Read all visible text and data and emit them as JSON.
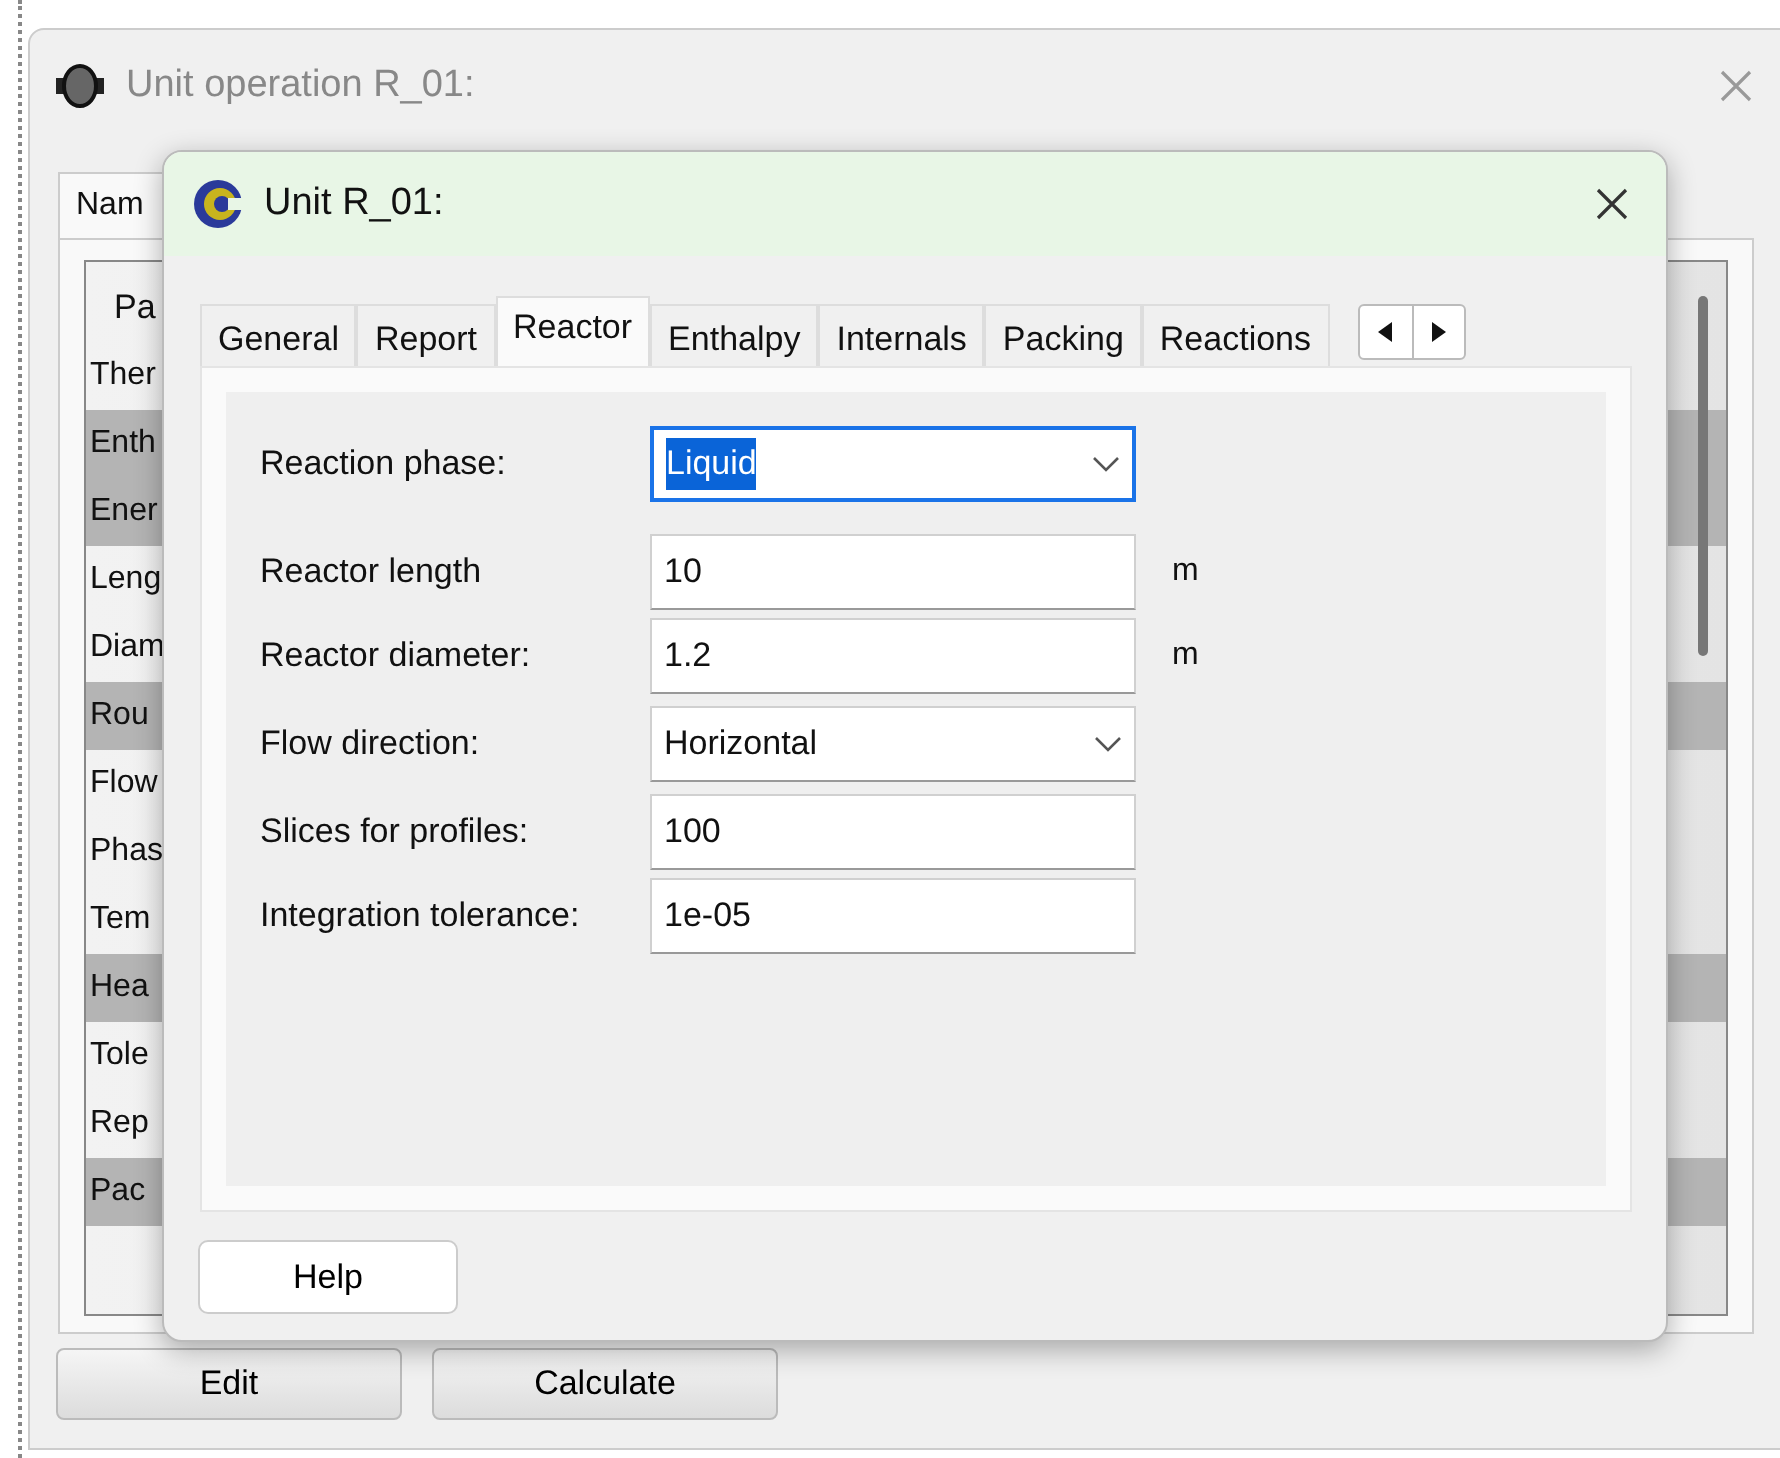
{
  "back_window": {
    "title": "Unit operation R_01:",
    "tabs": [
      {
        "label": "Nam",
        "selected": true
      }
    ],
    "list": {
      "header": "Pa",
      "rows": [
        {
          "text": "Ther",
          "highlighted": false
        },
        {
          "text": "Enth",
          "highlighted": true
        },
        {
          "text": "Ener",
          "highlighted": true
        },
        {
          "text": "Leng",
          "highlighted": false
        },
        {
          "text": "Diam",
          "highlighted": false
        },
        {
          "text": "Rou",
          "highlighted": true
        },
        {
          "text": "Flow",
          "highlighted": false
        },
        {
          "text": "Phas",
          "highlighted": false
        },
        {
          "text": "Tem",
          "highlighted": false
        },
        {
          "text": "Hea",
          "highlighted": true
        },
        {
          "text": "Tole",
          "highlighted": false
        },
        {
          "text": "Rep",
          "highlighted": false
        },
        {
          "text": "Pac",
          "highlighted": true
        }
      ]
    },
    "buttons": [
      "Edit",
      "Calculate"
    ]
  },
  "dialog": {
    "title": "Unit R_01:",
    "tabs": [
      {
        "label": "General",
        "selected": false
      },
      {
        "label": "Report",
        "selected": false
      },
      {
        "label": "Reactor",
        "selected": true
      },
      {
        "label": "Enthalpy",
        "selected": false
      },
      {
        "label": "Internals",
        "selected": false
      },
      {
        "label": "Packing",
        "selected": false
      },
      {
        "label": "Reactions",
        "selected": false
      }
    ],
    "fields": [
      {
        "kind": "select",
        "label": "Reaction phase:",
        "value": "Liquid",
        "focused": true
      },
      {
        "kind": "input",
        "label": "Reactor length",
        "value": "10",
        "unit": "m",
        "focused": false
      },
      {
        "kind": "input",
        "label": "Reactor diameter:",
        "value": "1.2",
        "unit": "m",
        "focused": false
      },
      {
        "kind": "select",
        "label": "Flow direction:",
        "value": "Horizontal",
        "focused": false
      },
      {
        "kind": "input",
        "label": "Slices for profiles:",
        "value": "100",
        "focused": false
      },
      {
        "kind": "input",
        "label": "Integration tolerance:",
        "value": "1e-05",
        "focused": false
      }
    ],
    "buttons": [
      "Help"
    ]
  }
}
